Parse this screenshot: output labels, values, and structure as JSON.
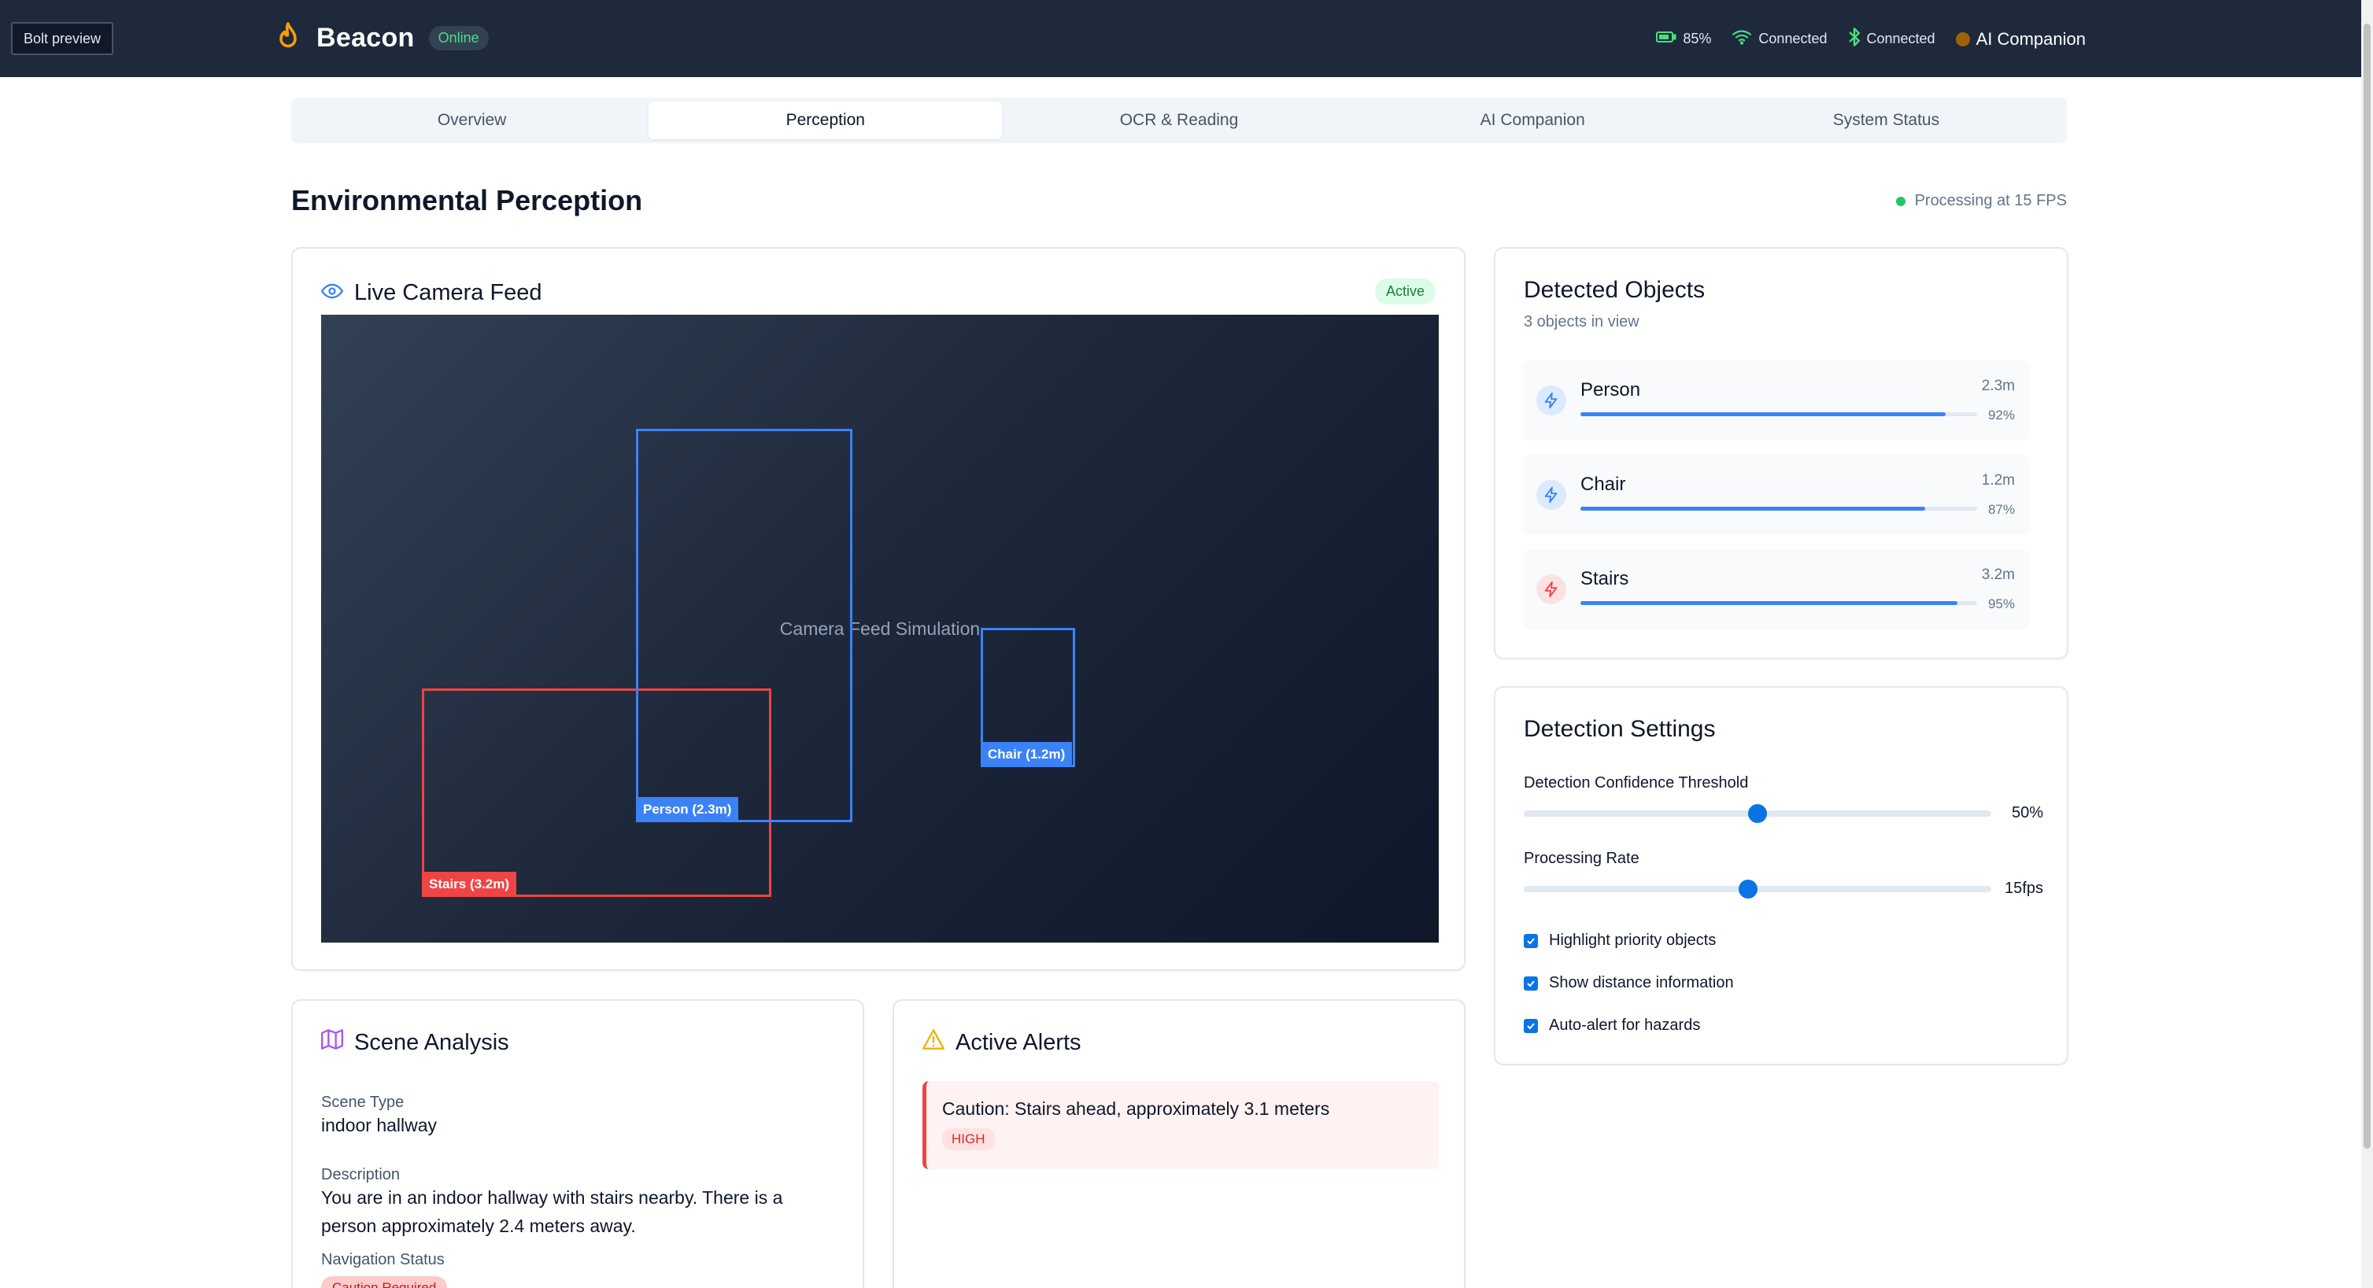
{
  "header": {
    "preview_chip": "Bolt preview",
    "brand_name": "Beacon",
    "online_badge": "Online",
    "battery": "85%",
    "wifi_status": "Connected",
    "bluetooth_status": "Connected",
    "ai_companion": "AI Companion"
  },
  "tabs": [
    {
      "label": "Overview"
    },
    {
      "label": "Perception"
    },
    {
      "label": "OCR & Reading"
    },
    {
      "label": "AI Companion"
    },
    {
      "label": "System Status"
    }
  ],
  "page": {
    "title": "Environmental Perception",
    "fps_status": "Processing at 15 FPS"
  },
  "camera": {
    "title": "Live Camera Feed",
    "badge": "Active",
    "caption": "Camera Feed Simulation",
    "boxes": {
      "person": "Person (2.3m)",
      "chair": "Chair (1.2m)",
      "stairs": "Stairs (3.2m)"
    }
  },
  "detected": {
    "title": "Detected Objects",
    "subtitle": "3 objects in view",
    "items": [
      {
        "name": "Person",
        "distance": "2.3m",
        "confidence": "92%",
        "confidence_value": 0.92,
        "color": "#3b82f6"
      },
      {
        "name": "Chair",
        "distance": "1.2m",
        "confidence": "87%",
        "confidence_value": 0.87,
        "color": "#3b82f6"
      },
      {
        "name": "Stairs",
        "distance": "3.2m",
        "confidence": "95%",
        "confidence_value": 0.95,
        "color": "#ef4444"
      }
    ]
  },
  "settings": {
    "title": "Detection Settings",
    "confidence_label": "Detection Confidence Threshold",
    "confidence_value": "50%",
    "confidence_level": 0.5,
    "rate_label": "Processing Rate",
    "rate_value": "15fps",
    "rate_level": 0.48,
    "checks": [
      {
        "label": "Highlight priority objects",
        "checked": true
      },
      {
        "label": "Show distance information",
        "checked": true
      },
      {
        "label": "Auto-alert for hazards",
        "checked": true
      }
    ]
  },
  "scene": {
    "title": "Scene Analysis",
    "type_label": "Scene Type",
    "type_value": "indoor hallway",
    "description_label": "Description",
    "description_value": "You are in an indoor hallway with stairs nearby. There is a person approximately 2.4 meters away.",
    "nav_label": "Navigation Status",
    "nav_value": "Caution Required"
  },
  "alerts": {
    "title": "Active Alerts",
    "items": [
      {
        "message": "Caution: Stairs ahead, approximately 3.1 meters",
        "severity": "HIGH"
      }
    ]
  },
  "colors": {
    "header_bg": "#1e293b",
    "accent_blue": "#3b82f6",
    "hazard_red": "#ef4444",
    "online_green": "#4ade80",
    "slider_blue": "#0b74e5"
  }
}
